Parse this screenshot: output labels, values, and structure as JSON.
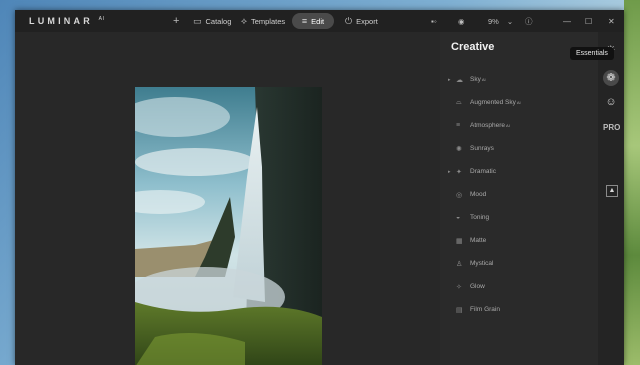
{
  "app": {
    "logo": "LUMINAR",
    "logo_version": "AI"
  },
  "nav": {
    "add_symbol": "+",
    "catalog": "Catalog",
    "templates": "Templates",
    "edit": "Edit",
    "export": "Export"
  },
  "toolbar": {
    "zoom": "9%",
    "zoom_caret": "⌄"
  },
  "panel": {
    "title": "Creative",
    "tools": [
      {
        "label": "Sky",
        "badge": "AI",
        "expandable": true
      },
      {
        "label": "Augmented Sky",
        "badge": "AI",
        "expandable": false
      },
      {
        "label": "Atmosphere",
        "badge": "AI",
        "expandable": false
      },
      {
        "label": "Sunrays",
        "badge": "",
        "expandable": false
      },
      {
        "label": "Dramatic",
        "badge": "",
        "expandable": true
      },
      {
        "label": "Mood",
        "badge": "",
        "expandable": false
      },
      {
        "label": "Toning",
        "badge": "",
        "expandable": false
      },
      {
        "label": "Matte",
        "badge": "",
        "expandable": false
      },
      {
        "label": "Mystical",
        "badge": "",
        "expandable": false
      },
      {
        "label": "Glow",
        "badge": "",
        "expandable": false
      },
      {
        "label": "Film Grain",
        "badge": "",
        "expandable": false
      }
    ]
  },
  "sidestrip": {
    "pro_label": "PRO"
  },
  "tooltip": {
    "text": "Essentials"
  },
  "icons": [
    "add-icon",
    "catalog-icon",
    "templates-icon",
    "edit-icon",
    "export-icon",
    "compare-icon",
    "eye-icon",
    "info-icon",
    "minimize-icon",
    "maximize-icon",
    "close-icon",
    "essentials-sun-icon",
    "creative-palette-icon",
    "portrait-face-icon",
    "local-masking-icon"
  ]
}
